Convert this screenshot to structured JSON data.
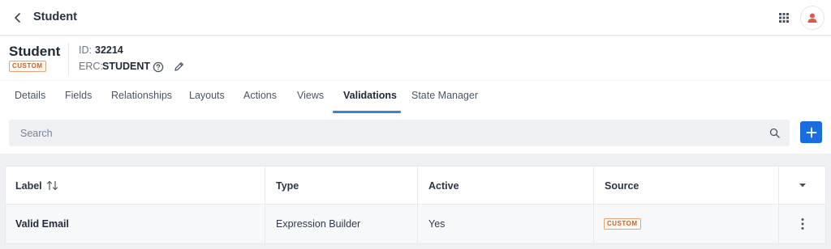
{
  "topbar": {
    "title": "Student",
    "back_icon": "chevron-left-icon",
    "apps_icon": "grid-icon",
    "avatar_icon": "user-icon",
    "avatar_color": "#e4574c"
  },
  "header": {
    "object_name": "Student",
    "badge": "CUSTOM",
    "id_label": "ID:",
    "id_value": "32214",
    "erc_label": "ERC:",
    "erc_value": "STUDENT",
    "help_icon": "help-circle-icon",
    "edit_icon": "pencil-icon"
  },
  "tabs": [
    {
      "label": "Details",
      "active": false
    },
    {
      "label": "Fields",
      "active": false
    },
    {
      "label": "Relationships",
      "active": false
    },
    {
      "label": "Layouts",
      "active": false
    },
    {
      "label": "Actions",
      "active": false
    },
    {
      "label": "Views",
      "active": false
    },
    {
      "label": "Validations",
      "active": true
    },
    {
      "label": "State Manager",
      "active": false
    }
  ],
  "search": {
    "placeholder": "Search",
    "icon": "search-icon"
  },
  "add_button": {
    "icon": "plus-icon",
    "color": "#1a6de0"
  },
  "table": {
    "columns": [
      "Label",
      "Type",
      "Active",
      "Source"
    ],
    "sort_icon": "sort-icon",
    "menu_icon": "caret-down-icon",
    "rows": [
      {
        "label": "Valid Email",
        "type": "Expression Builder",
        "active": "Yes",
        "source": "CUSTOM"
      }
    ]
  },
  "colors": {
    "accent": "#3d7fd9",
    "badge_text": "#c2652a",
    "badge_border": "#e4a275"
  }
}
